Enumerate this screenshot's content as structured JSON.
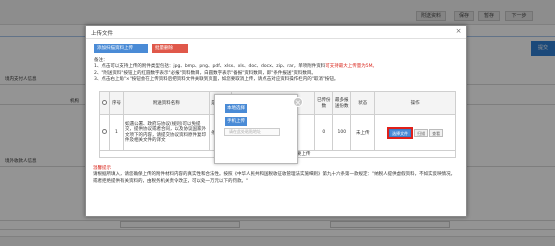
{
  "background": {
    "top_buttons": [
      "附送资料",
      "保存",
      "暂存",
      "下一步"
    ],
    "right_button": "提交",
    "section_1": "境内支付人信息",
    "section_2": "境外收款人信息",
    "left_label": "机构"
  },
  "dialog": {
    "title": "上传文件",
    "close": "×",
    "btn_add": "添加扫描资料上传",
    "btn_delete": "批量删除",
    "notes": [
      "备注：",
      "1、点击可以支持上传的附件类型包括：jpg、bmp、png、pdf、xlsx、xls、doc、docx、zip、rar，单项附件资料可支持最大上传量为5M。",
      "2、\"附送资料\"按钮上的红圆数字表示\"必报\"资料数目，白圆数字表示\"备报\"资料数目，即\"条件报送\"资料数目。",
      "3、点击右上角\"×\"按钮会在上传资料后把资料文件关联到页面，如您要取消上传，请点击对应资料操作栏内的\"取消\"按钮。"
    ],
    "notes_red": "可支持最大上传量为5M。",
    "table": {
      "headers": [
        "",
        "序号",
        "附送资料名称",
        "是否必报",
        "资料示例",
        "已传份数",
        "最多报送份数",
        "状态",
        "操作"
      ],
      "row": {
        "index": "1",
        "name": "如遇公署、政府与协议(规则)可以免提交，提供协议或者合同，以及协议国家外文项下的内容，请提交协议资料原件复印件及相关文件的译文",
        "required": "条件报送",
        "uploaded": "0",
        "max": "100",
        "status": "未上传",
        "op_select": "选择文件",
        "op_scan": "扫描",
        "op_view": "查看"
      },
      "footer": "该事项共有1个附送资料需要上传"
    },
    "warning_title": "温馨提示",
    "warning_text": "请根据所填入，请您确保上传的附件材料内容的真实性和合法性。按照《中华人民共和国税收征收管理法实施细则》第九十六条第一款规定：\"纳税人提供虚假资料，不如实反映情况，或者拒绝提供有关资料的，由税务机关责令改正，可以处一万元以下的罚款。\""
  },
  "popup": {
    "close": "×",
    "btn_local": "本地选择",
    "btn_mobile": "手机上传",
    "input_placeholder": "请在此处粘贴地址"
  }
}
